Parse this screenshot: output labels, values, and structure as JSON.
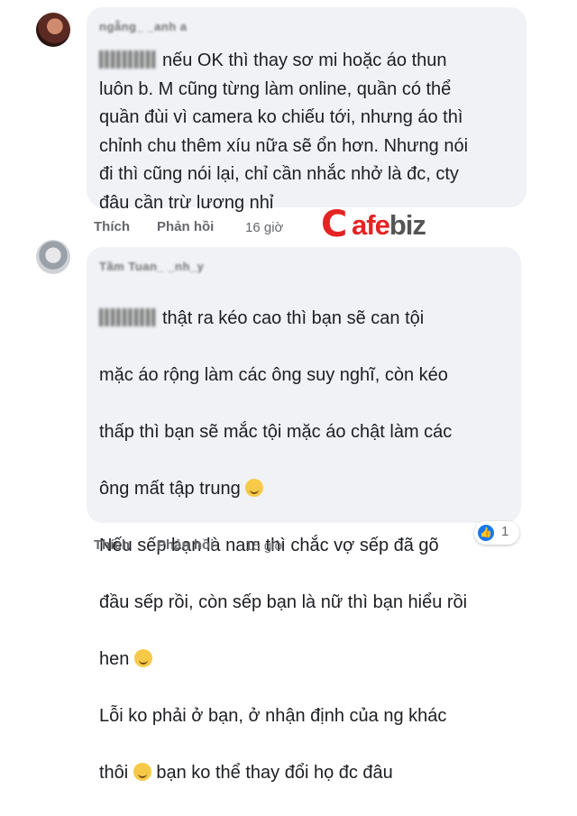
{
  "comments": [
    {
      "author": "ngẫng_ _anh a",
      "text": "nếu OK thì thay sơ mi hoặc áo thun\nluôn b. M cũng từng làm online, quần có thể\nquần đùi vì camera ko chiếu tới, nhưng áo thì\nchỉnh chu thêm xíu nữa sẽ ổn hơn. Nhưng nói\nđi thì cũng nói lại, chỉ cần nhắc nhở là đc, cty\nđâu cần trừ lương nhỉ",
      "like_label": "Thích",
      "reply_label": "Phản hồi",
      "time": "16 giờ"
    },
    {
      "author": "Tầm Tuan_ _nh_y",
      "text_lines": [
        "thật ra kéo cao thì bạn sẽ can tội",
        "mặc áo rộng làm các ông suy nghĩ, còn kéo",
        "thấp thì bạn sẽ mắc tội mặc áo chật làm các",
        "ông mất tập trung",
        "Nếu sếp bạn là nam thì chắc vợ sếp đã gõ",
        "đầu sếp rồi, còn sếp bạn là nữ thì bạn hiểu rồi",
        "hen",
        "Lỗi ko phải ở bạn, ở nhận định của ng khác",
        "thôi",
        "bạn ko thể thay đổi họ đc đâu"
      ],
      "like_label": "Thích",
      "reply_label": "Phản hồi",
      "time": "15 giờ",
      "reaction_count": "1"
    }
  ],
  "logo": {
    "c": "C",
    "afe": "afe",
    "biz": "biz"
  },
  "colors": {
    "bubble": "#f0f2f5",
    "secondary_text": "#65676b",
    "like_blue": "#1877f2",
    "logo_red": "#e42323"
  }
}
